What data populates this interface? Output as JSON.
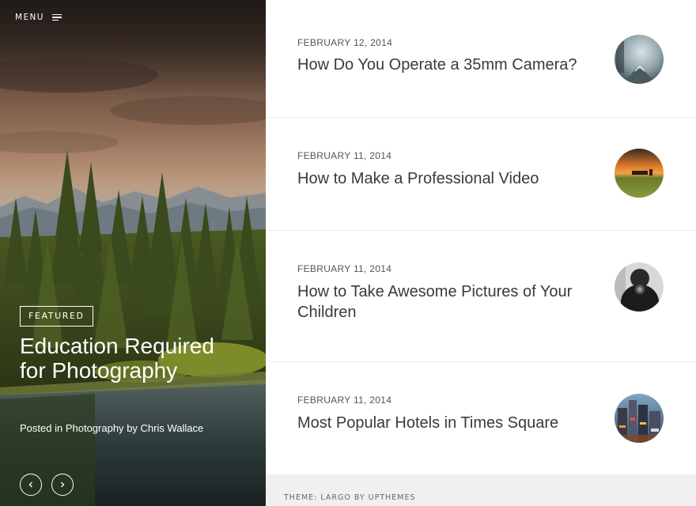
{
  "menu": {
    "label": "MENU",
    "icon": "hamburger-icon"
  },
  "featured": {
    "badge": "FEATURED",
    "title": "Education Required for Photography",
    "meta_prefix": "Posted in",
    "category": "Photography",
    "meta_by": "by",
    "author": "Chris Wallace",
    "prev_icon": "chevron-left-icon",
    "next_icon": "chevron-right-icon"
  },
  "posts": [
    {
      "date": "FEBRUARY 12, 2014",
      "title": "How Do You Operate a 35mm Camera?"
    },
    {
      "date": "FEBRUARY 11, 2014",
      "title": "How to Make a Professional Video"
    },
    {
      "date": "FEBRUARY 11, 2014",
      "title": "How to Take Awesome Pictures of Your Children"
    },
    {
      "date": "FEBRUARY 11, 2014",
      "title": "Most Popular Hotels in Times Square"
    }
  ],
  "footer": {
    "text": "THEME: LARGO BY UPTHEMES"
  },
  "colors": {
    "hero_sky": "#8e6b54",
    "forest": "#3d4a1f",
    "footer_bg": "#f0f0f0",
    "text": "#3a3a3a"
  }
}
